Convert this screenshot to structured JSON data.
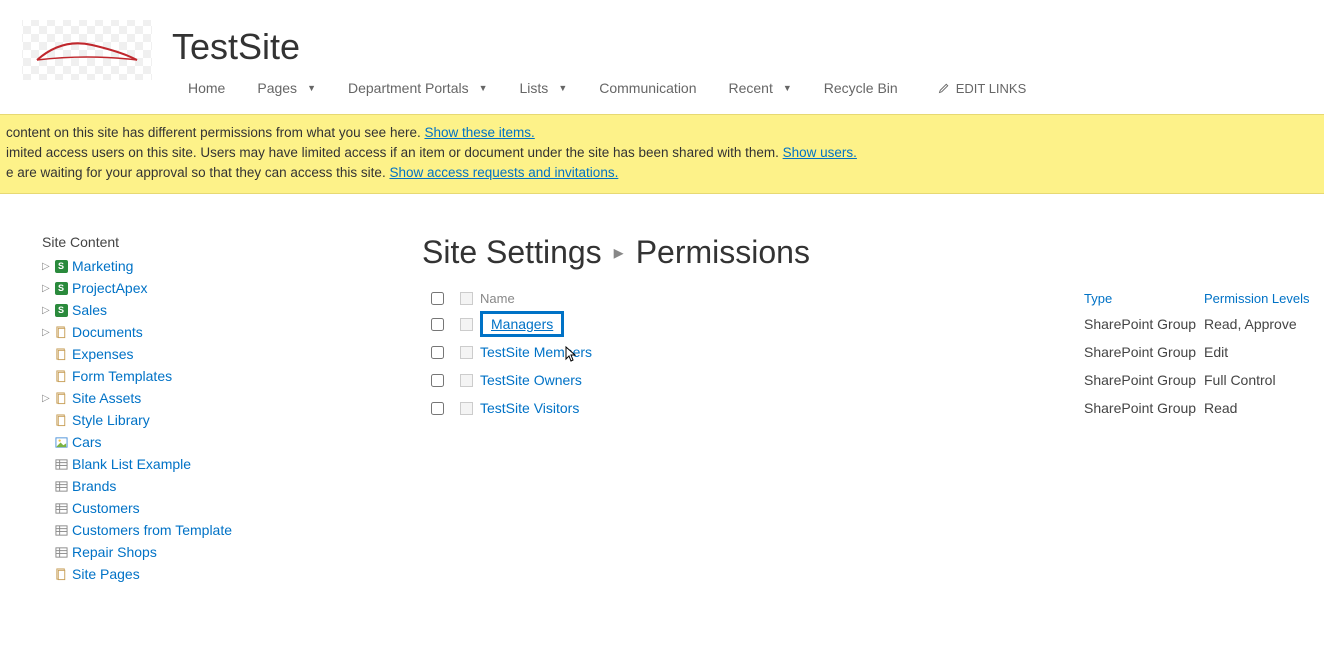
{
  "site": {
    "title": "TestSite"
  },
  "nav": {
    "items": [
      {
        "label": "Home",
        "dropdown": false
      },
      {
        "label": "Pages",
        "dropdown": true
      },
      {
        "label": "Department Portals",
        "dropdown": true
      },
      {
        "label": "Lists",
        "dropdown": true
      },
      {
        "label": "Communication",
        "dropdown": false
      },
      {
        "label": "Recent",
        "dropdown": true
      },
      {
        "label": "Recycle Bin",
        "dropdown": false
      }
    ],
    "edit_links": "EDIT LINKS"
  },
  "notifications": {
    "line1_prefix": " content on this site has different permissions from what you see here.  ",
    "line1_link": "Show these items.",
    "line2_prefix": "imited access users on this site. Users may have limited access if an item or document under the site has been shared with them. ",
    "line2_link": "Show users.",
    "line3_prefix": "e are waiting for your approval so that they can access this site. ",
    "line3_link": "Show access requests and invitations."
  },
  "sidebar": {
    "title": "Site Content",
    "items": [
      {
        "label": "Marketing",
        "icon": "sp",
        "expandable": true
      },
      {
        "label": "ProjectApex",
        "icon": "sp",
        "expandable": true
      },
      {
        "label": "Sales",
        "icon": "sp",
        "expandable": true
      },
      {
        "label": "Documents",
        "icon": "lib",
        "expandable": true
      },
      {
        "label": "Expenses",
        "icon": "lib",
        "expandable": false
      },
      {
        "label": "Form Templates",
        "icon": "lib",
        "expandable": false
      },
      {
        "label": "Site Assets",
        "icon": "lib",
        "expandable": true
      },
      {
        "label": "Style Library",
        "icon": "lib",
        "expandable": false
      },
      {
        "label": "Cars",
        "icon": "img",
        "expandable": false
      },
      {
        "label": "Blank List Example",
        "icon": "list",
        "expandable": false
      },
      {
        "label": "Brands",
        "icon": "list",
        "expandable": false
      },
      {
        "label": "Customers",
        "icon": "list",
        "expandable": false
      },
      {
        "label": "Customers from Template",
        "icon": "list",
        "expandable": false
      },
      {
        "label": "Repair Shops",
        "icon": "list",
        "expandable": false
      },
      {
        "label": "Site Pages",
        "icon": "lib",
        "expandable": false
      }
    ]
  },
  "breadcrumb": {
    "part1": "Site Settings",
    "part2": "Permissions"
  },
  "table": {
    "headers": {
      "name": "Name",
      "type": "Type",
      "level": "Permission Levels"
    },
    "rows": [
      {
        "name": "Managers",
        "type": "SharePoint Group",
        "level": "Read, Approve",
        "highlight": true
      },
      {
        "name": "TestSite Members",
        "type": "SharePoint Group",
        "level": "Edit",
        "highlight": false
      },
      {
        "name": "TestSite Owners",
        "type": "SharePoint Group",
        "level": "Full Control",
        "highlight": false
      },
      {
        "name": "TestSite Visitors",
        "type": "SharePoint Group",
        "level": "Read",
        "highlight": false
      }
    ]
  }
}
